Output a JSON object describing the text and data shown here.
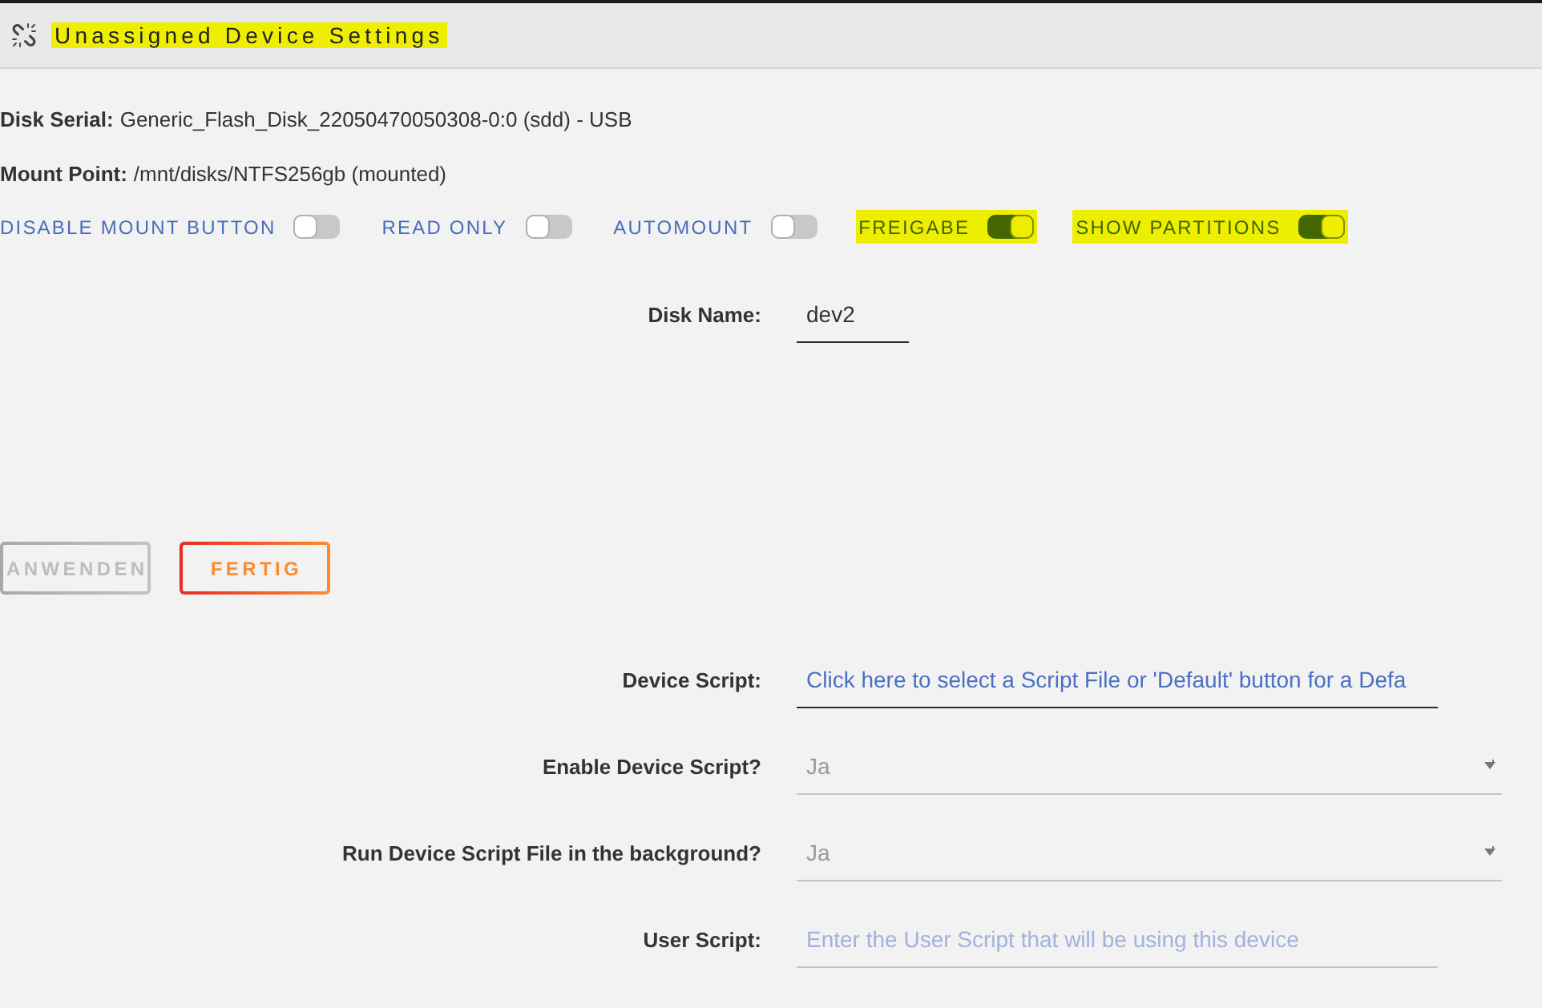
{
  "header": {
    "title": "Unassigned Device Settings",
    "highlighted": true
  },
  "info": [
    {
      "label": "Disk Serial:",
      "value": "Generic_Flash_Disk_22050470050308-0:0 (sdd) - USB"
    },
    {
      "label": "Mount Point:",
      "value": "/mnt/disks/NTFS256gb (mounted)"
    }
  ],
  "toggles": [
    {
      "label": "DISABLE MOUNT BUTTON",
      "on": false,
      "highlighted": false
    },
    {
      "label": "READ ONLY",
      "on": false,
      "highlighted": false
    },
    {
      "label": "AUTOMOUNT",
      "on": false,
      "highlighted": false
    },
    {
      "label": "FREIGABE",
      "on": true,
      "highlighted": true
    },
    {
      "label": "SHOW PARTITIONS",
      "on": true,
      "highlighted": true
    }
  ],
  "disk_name": {
    "label": "Disk Name:",
    "value": "dev2"
  },
  "buttons": [
    {
      "label": "ANWENDEN",
      "disabled": true
    },
    {
      "label": "FERTIG",
      "disabled": false
    }
  ],
  "script_fields": [
    {
      "kind": "file",
      "label": "Device Script:",
      "value": "Click here to select a Script File or 'Default' button for a Defa"
    },
    {
      "kind": "select",
      "label": "Enable Device Script?",
      "value": "Ja"
    },
    {
      "kind": "select",
      "label": "Run Device Script File in the background?",
      "value": "Ja"
    },
    {
      "kind": "text",
      "label": "User Script:",
      "placeholder": "Enter the User Script that will be using this device"
    }
  ]
}
